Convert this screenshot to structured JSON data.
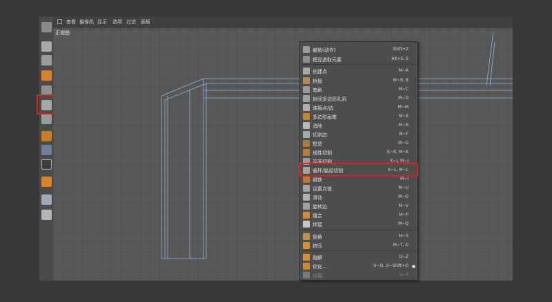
{
  "menubar": {
    "items": [
      "查看",
      "摄像机",
      "显示",
      "选项",
      "过滤",
      "面板"
    ]
  },
  "viewport": {
    "label": "正视图"
  },
  "toolbar": {
    "icons": [
      "c4d-logo-icon",
      "cube-mode-icon",
      "checker-icon",
      "texture-icon",
      "point-mode-icon",
      "polygon-mode-icon",
      "model-mode-icon",
      "axis-icon",
      "mouse-icon",
      "snap-s-icon",
      "magnet-icon",
      "workplane-icon",
      "lock-icon"
    ]
  },
  "menu": {
    "items": [
      {
        "label": "撤销(动作)",
        "shortcut": "Shift+Z",
        "icon": "undo-icon"
      },
      {
        "label": "框显选取元素",
        "shortcut": "Alt+S, S",
        "icon": "frame-icon"
      },
      {
        "label": "创建点",
        "shortcut": "M~A",
        "icon": "create-point-icon"
      },
      {
        "label": "桥接",
        "shortcut": "M~B, B",
        "icon": "bridge-icon"
      },
      {
        "label": "笔刷",
        "shortcut": "M~C",
        "icon": "brush-icon"
      },
      {
        "label": "封闭多边形孔洞",
        "shortcut": "M~D",
        "icon": "close-hole-icon"
      },
      {
        "label": "连接点/边",
        "shortcut": "M~M",
        "icon": "connect-icon"
      },
      {
        "label": "多边形画笔",
        "shortcut": "M~E",
        "icon": "polygon-pen-icon"
      },
      {
        "label": "消除",
        "shortcut": "M~N",
        "icon": "dissolve-icon"
      },
      {
        "label": "切割边",
        "shortcut": "M~F",
        "icon": "edge-cut-icon"
      },
      {
        "label": "熨烫",
        "shortcut": "M~G",
        "icon": "iron-icon"
      },
      {
        "label": "线性切割",
        "shortcut": "K~K, M~K",
        "icon": "knife-icon"
      },
      {
        "label": "平面切割",
        "shortcut": "K~J, M~J",
        "icon": "plane-cut-icon"
      },
      {
        "label": "循环/路径切割",
        "shortcut": "K~L, M~L",
        "icon": "loop-cut-icon"
      },
      {
        "label": "磁铁",
        "shortcut": "M~I",
        "icon": "magnet-tool-icon"
      },
      {
        "label": "设置点值",
        "shortcut": "M~U",
        "icon": "set-value-icon"
      },
      {
        "label": "滑动",
        "shortcut": "M~O",
        "icon": "slide-icon"
      },
      {
        "label": "旋转边",
        "shortcut": "M~V",
        "icon": "spin-edge-icon"
      },
      {
        "label": "缝合",
        "shortcut": "M~P",
        "icon": "stitch-icon"
      },
      {
        "label": "焊接",
        "shortcut": "M~Q",
        "icon": "weld-icon"
      },
      {
        "label": "倒角",
        "shortcut": "M~S",
        "icon": "bevel-icon"
      },
      {
        "label": "挤压",
        "shortcut": "M~T, D",
        "icon": "extrude-icon"
      },
      {
        "label": "融解",
        "shortcut": "U~Z",
        "icon": "melt-icon"
      },
      {
        "label": "优化...",
        "shortcut": "U~O, U~Shift+O",
        "icon": "optimize-icon"
      },
      {
        "label": "分裂",
        "shortcut": "U~P",
        "icon": "split-icon"
      }
    ]
  },
  "colors": {
    "highlight": "#e0201c",
    "wire": "#8fb5e0",
    "icon_orange": "#e08a2c",
    "icon_gray": "#9a9a9a"
  }
}
